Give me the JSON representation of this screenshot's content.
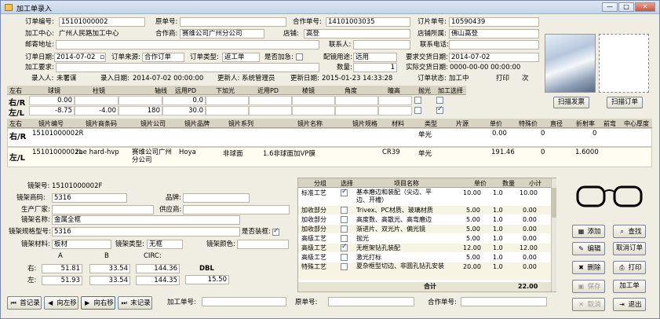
{
  "window": {
    "title": "加工单录入"
  },
  "header": {
    "order_no_label": "订单编号:",
    "order_no": "15101000002",
    "orig_no_label": "原单号:",
    "orig_no": "",
    "contract_no_label": "合作单号:",
    "contract_no": "14101003035",
    "piece_no_label": "订片单号:",
    "piece_no": "10590439",
    "center_label": "加工中心:",
    "center": "广州人民路加工中心",
    "partner_label": "合作商:",
    "partner": "赛维公司广州分公司",
    "shop_label": "店铺:",
    "shop": "高登",
    "shop_area_label": "店铺所属:",
    "shop_area": "佛山高登",
    "address_label": "邮寄地址:",
    "address": "",
    "contact_label": "联系人:",
    "contact": "",
    "phone_label": "联系电话:",
    "phone": "",
    "order_date_label": "订单日期:",
    "order_date": "2014-07-02",
    "source_label": "订单来源:",
    "source": "合作订单",
    "type_label": "订单类型:",
    "type": "返工单",
    "urgent_label": "是否加急:",
    "use_label": "配镜用途:",
    "use": "远用",
    "req_date_label": "要求交货日期:",
    "req_date": "2014-07-02",
    "req_label": "加工要求:",
    "req": "",
    "qty_label": "数量:",
    "qty": "1",
    "actual_label": "实际交货日期:",
    "actual": "0000-00-00 00:00:00",
    "entry_user_label": "录入人:",
    "entry_user": "未署谋",
    "entry_date_label": "录入日期:",
    "entry_date": "2014-07-02 00:00:00",
    "updater_label": "更新人:",
    "updater": "系统管理员",
    "update_date_label": "更新日期:",
    "update_date": "2015-01-23 14:33:28",
    "status_label": "订单状态:",
    "status": "加工中",
    "print_label": "打印",
    "times_label": "次"
  },
  "rx": {
    "headers": [
      "左右",
      "球镜",
      "柱镜",
      "轴线",
      "远用PD",
      "下加光",
      "近用PD",
      "棱镜",
      "角度",
      "瞳高",
      "抛光",
      "加工选择"
    ],
    "rows": [
      {
        "side": "右/R",
        "sph": "0.00",
        "cyl": "",
        "axis": "",
        "pd": "0.0",
        "add": "",
        "npd": "",
        "prism": "",
        "angle": "",
        "height": "",
        "polish": false,
        "proc": false
      },
      {
        "side": "左/L",
        "sph": "-8.75",
        "cyl": "-4.00",
        "axis": "180",
        "pd": "30.0",
        "add": "",
        "npd": "",
        "prism": "",
        "angle": "",
        "height": "",
        "polish": false,
        "proc": true
      }
    ]
  },
  "buttons": {
    "scan_invoice": "扫描发票",
    "scan_order": "扫描订单"
  },
  "lens": {
    "headers": [
      "左右",
      "镜片编号",
      "镜片商条码",
      "镜片公司",
      "镜片品牌",
      "镜片系列",
      "镜片名称",
      "镜片规格",
      "材料",
      "类型",
      "片源",
      "单价",
      "特殊价",
      "直径",
      "折射率",
      "前弯",
      "中心厚度"
    ],
    "rows": [
      {
        "side": "右/R",
        "code": "15101000002R",
        "barcode": "",
        "company": "",
        "brand": "",
        "series": "",
        "name": "",
        "spec": "",
        "material": "",
        "type": "单光",
        "source": "",
        "price": "0.00",
        "special": "0",
        "dia": "",
        "index": "0",
        "front": "",
        "center": ""
      },
      {
        "side": "左/L",
        "code": "15101000002L",
        "barcode": "zae hard-hvp",
        "company": "赛维公司广州分公司",
        "brand": "Hoya",
        "series": "非球面",
        "name": "1.6非球面加VP膜",
        "spec": "",
        "material": "CR39",
        "type": "单光",
        "source": "",
        "price": "191.46",
        "special": "0",
        "dia": "",
        "index": "1.6000",
        "front": "",
        "center": ""
      }
    ]
  },
  "frame": {
    "no_label": "镜架号:",
    "no": "15101000002F",
    "barcode_label": "镜架商码:",
    "barcode": "5316",
    "brand_label": "品牌:",
    "brand": "",
    "maker_label": "生产厂家:",
    "maker": "",
    "supplier_label": "供应商:",
    "supplier": "",
    "name_label": "镜架名称:",
    "name": "金属全框",
    "model_label": "镜架规格型号:",
    "model": "5316",
    "mounted_label": "是否装框:",
    "material_label": "镜架材料:",
    "material": "板材",
    "ftype_label": "镜架类型:",
    "ftype": "无框",
    "color_label": "镜架颜色:",
    "color": "",
    "a_label": "A",
    "b_label": "B",
    "circ_label": "CIRC:",
    "dbl_label": "DBL",
    "right_label": "右:",
    "left_label": "左:",
    "r_a": "51.81",
    "r_b": "33.54",
    "r_circ": "144.36",
    "l_a": "51.93",
    "l_b": "33.54",
    "l_circ": "144.35",
    "dbl": "15.50"
  },
  "process": {
    "headers": [
      "分组",
      "选择",
      "项目名称",
      "单价",
      "数量",
      "小计"
    ],
    "rows": [
      {
        "group": "标准工艺",
        "checked": true,
        "name": "基本磨边和装配（尖边、平边、开槽）",
        "price": "10.00",
        "qty": "1.0",
        "sub": "10.00"
      },
      {
        "group": "加收部分",
        "checked": false,
        "name": "Trivex、PC材质、玻璃材质",
        "price": "5.00",
        "qty": "1.0",
        "sub": "0.00"
      },
      {
        "group": "加收部分",
        "checked": false,
        "name": "高度数、高散光、高弯磨边",
        "price": "5.00",
        "qty": "1.0",
        "sub": "0.00"
      },
      {
        "group": "加收部分",
        "checked": false,
        "name": "渐进片、双光片、偏光镜",
        "price": "5.00",
        "qty": "1.0",
        "sub": "0.00"
      },
      {
        "group": "高级工艺",
        "checked": false,
        "name": "抛光",
        "price": "5.00",
        "qty": "1.0",
        "sub": "0.00"
      },
      {
        "group": "高级工艺",
        "checked": true,
        "name": "无框架钻孔装配",
        "price": "12.00",
        "qty": "1.0",
        "sub": "12.00"
      },
      {
        "group": "高级工艺",
        "checked": false,
        "name": "激光打标",
        "price": "5.00",
        "qty": "1.0",
        "sub": "0.00"
      },
      {
        "group": "特殊工艺",
        "checked": false,
        "name": "夏杂框型切边、非圆孔钻孔安装",
        "price": "20.00",
        "qty": "1.0",
        "sub": "0.00"
      }
    ],
    "total_label": "合计",
    "total": "22.00"
  },
  "actions": {
    "add": "添加",
    "search": "查找",
    "edit": "编辑",
    "cancel": "取消订单",
    "delete": "删除",
    "print": "打印",
    "save": "保存",
    "process": "加工单",
    "cancel2": "取消",
    "exit": "退出"
  },
  "nav": {
    "first": "首记录",
    "prev": "向左移",
    "next": "向右移",
    "last": "末记录",
    "proc_no_label": "加工单号:",
    "proc_no": "",
    "orig_no_label": "原单号:",
    "orig_no": "",
    "contract_no_label": "合作单号:",
    "contract_no": ""
  }
}
